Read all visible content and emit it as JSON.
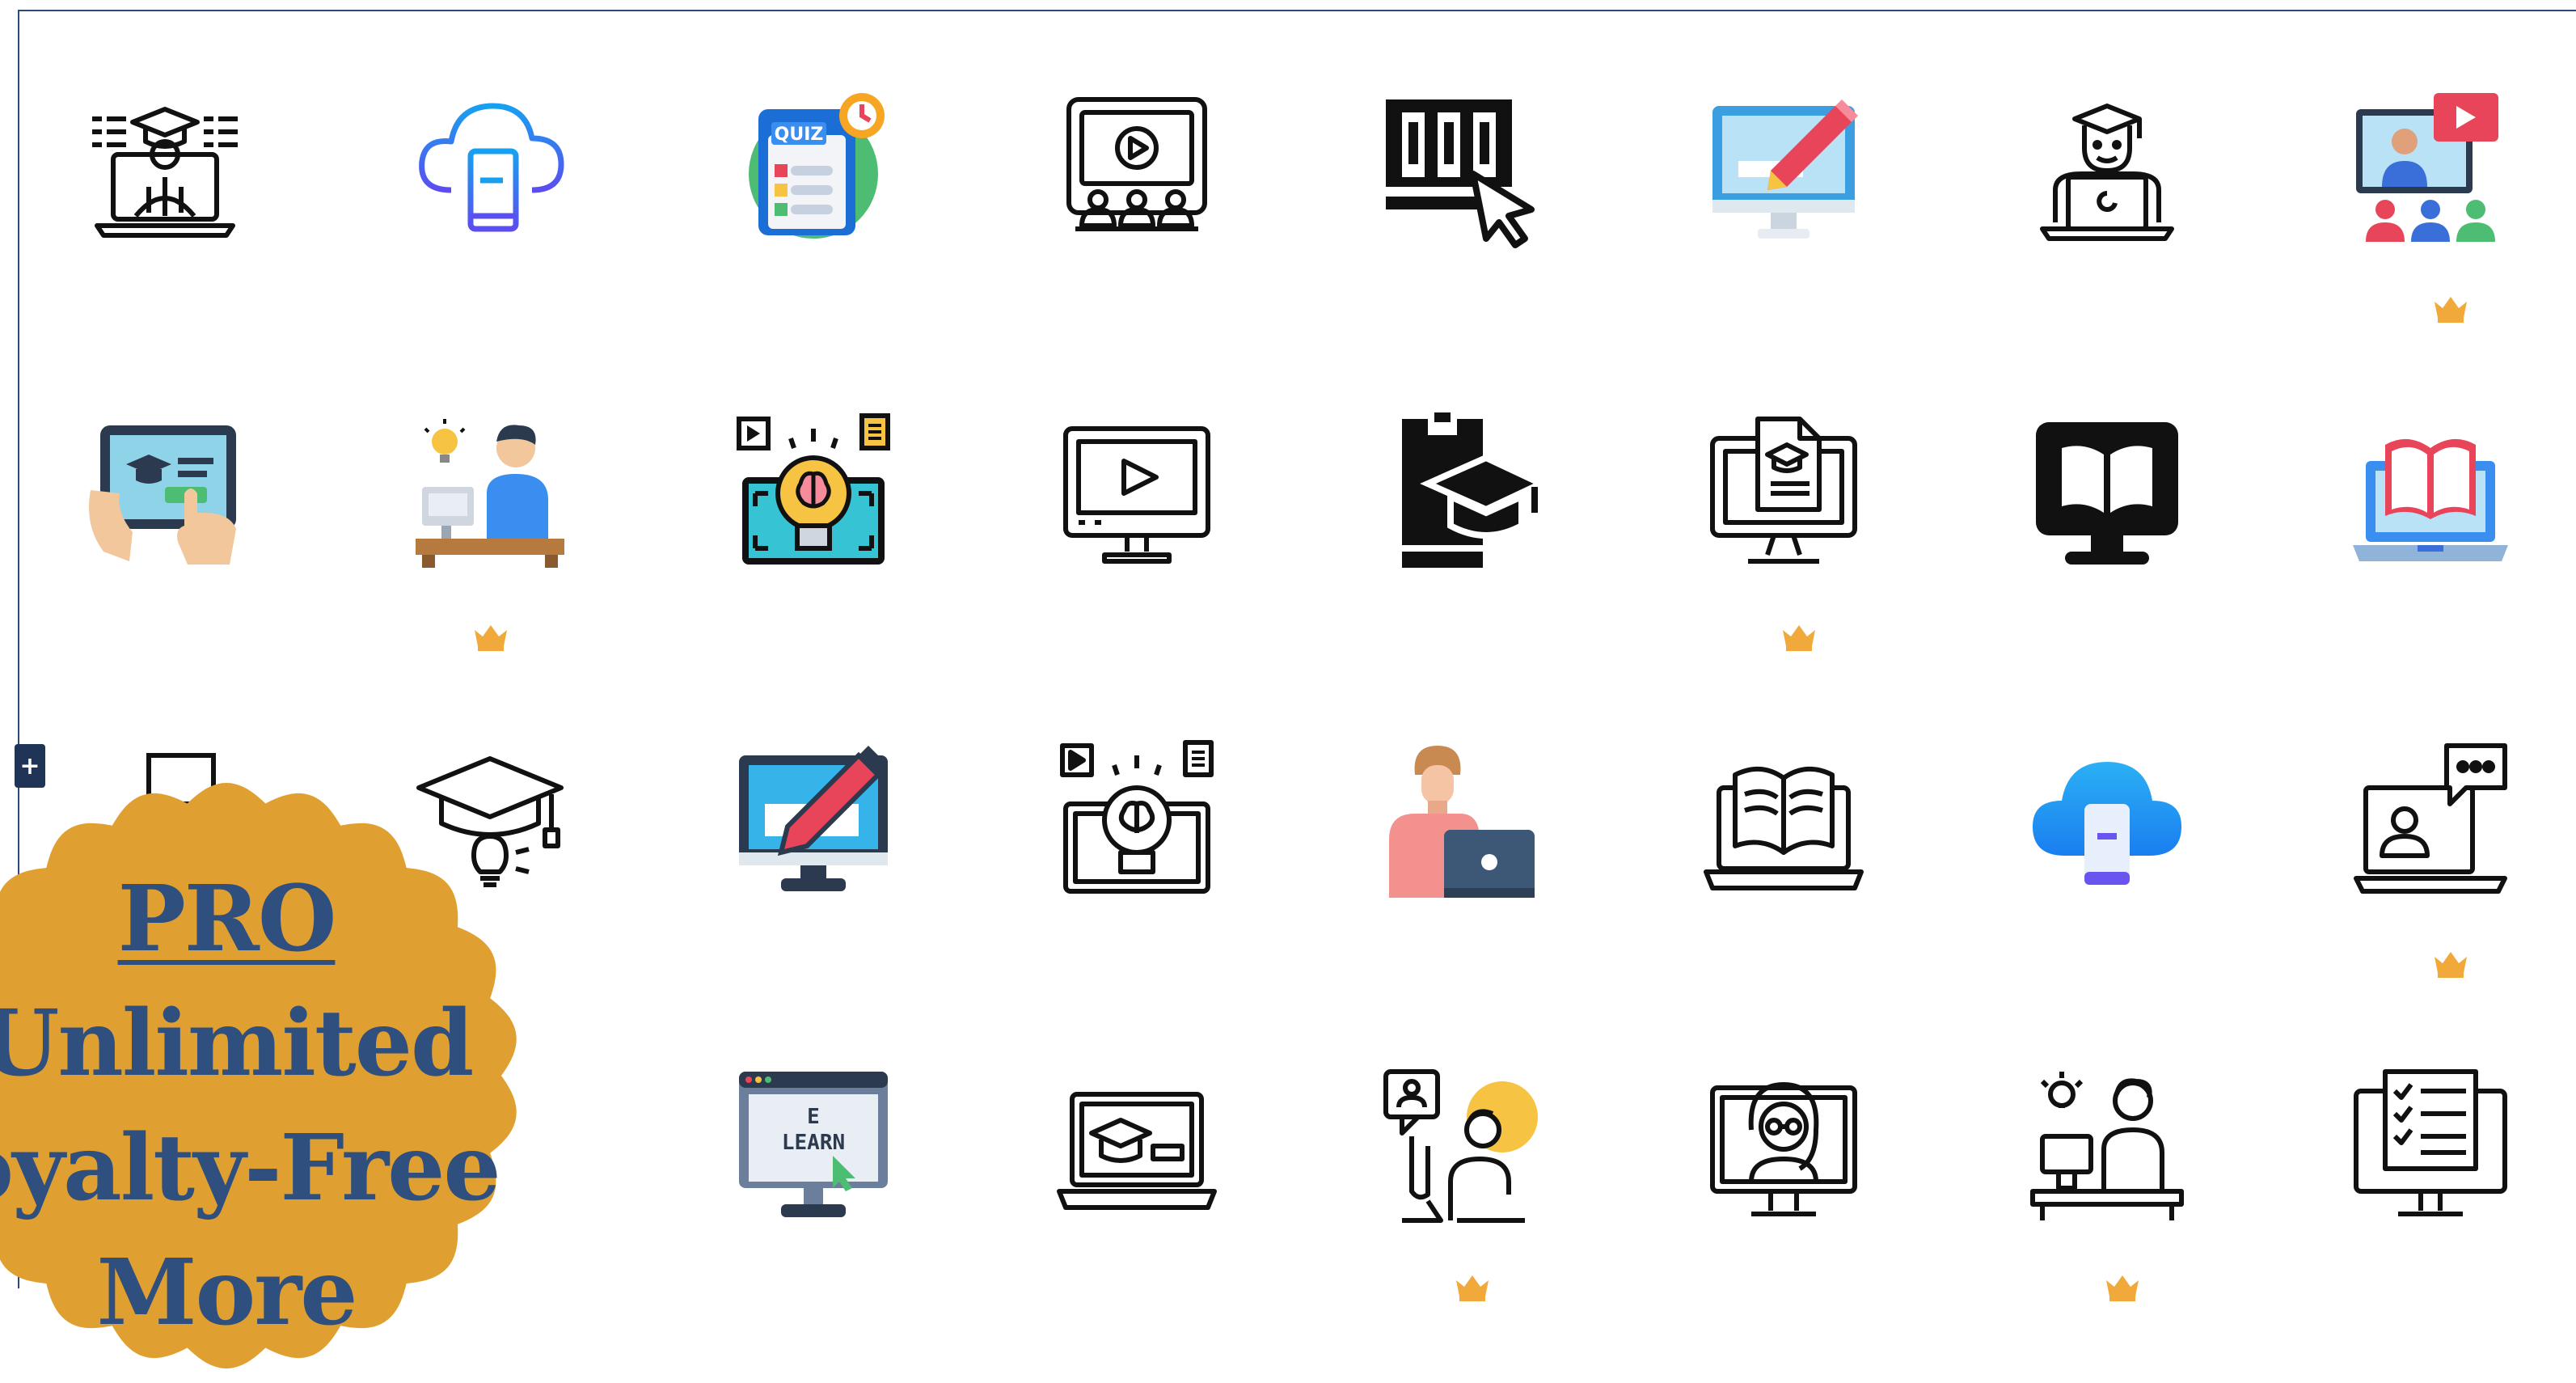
{
  "colors": {
    "frame_border": "#2c4a7c",
    "crown_gold": "#f0a93a",
    "promo_badge": "#e09f31",
    "promo_text": "#2f4f7f",
    "plus_button": "#1f3457"
  },
  "icons": [
    {
      "name": "online-graduate-laptop-icon",
      "style": "line",
      "pro": false
    },
    {
      "name": "cloud-book-icon",
      "style": "gradient",
      "pro": false
    },
    {
      "name": "quiz-icon",
      "style": "flat",
      "pro": false,
      "label": "QUIZ"
    },
    {
      "name": "video-presentation-icon",
      "style": "line",
      "pro": false
    },
    {
      "name": "library-click-icon",
      "style": "glyph",
      "pro": false
    },
    {
      "name": "monitor-pencil-icon",
      "style": "flat",
      "pro": false
    },
    {
      "name": "student-laptop-icon",
      "style": "line",
      "pro": false
    },
    {
      "name": "video-conference-icon",
      "style": "flat",
      "pro": true
    },
    {
      "name": "tablet-graduation-icon",
      "style": "flat",
      "pro": false
    },
    {
      "name": "student-desk-idea-icon",
      "style": "flat",
      "pro": true
    },
    {
      "name": "brain-bulb-screen-icon",
      "style": "flat",
      "pro": false
    },
    {
      "name": "monitor-play-icon",
      "style": "line",
      "pro": false
    },
    {
      "name": "phone-graduation-icon",
      "style": "glyph",
      "pro": false
    },
    {
      "name": "monitor-diploma-icon",
      "style": "line",
      "pro": true
    },
    {
      "name": "monitor-book-icon",
      "style": "glyph",
      "pro": false
    },
    {
      "name": "laptop-book-icon",
      "style": "flat",
      "pro": false
    },
    {
      "name": "partial-icon",
      "style": "line",
      "pro": false
    },
    {
      "name": "graduation-cap-bulb-icon",
      "style": "line",
      "pro": false
    },
    {
      "name": "monitor-pencil-flat-icon",
      "style": "flat",
      "pro": false
    },
    {
      "name": "brain-bulb-line-icon",
      "style": "line",
      "pro": false
    },
    {
      "name": "person-laptop-icon",
      "style": "flat",
      "pro": false
    },
    {
      "name": "laptop-open-book-icon",
      "style": "line",
      "pro": false
    },
    {
      "name": "cloud-phone-icon",
      "style": "gradient",
      "pro": false
    },
    {
      "name": "video-chat-icon",
      "style": "line",
      "pro": true
    },
    {
      "name": "hidden-icon-1",
      "style": "line",
      "pro": false
    },
    {
      "name": "hidden-icon-2",
      "style": "line",
      "pro": false
    },
    {
      "name": "e-learn-monitor-icon",
      "style": "flat",
      "pro": false,
      "label": "E LEARN"
    },
    {
      "name": "laptop-graduation-icon",
      "style": "line",
      "pro": false
    },
    {
      "name": "student-question-icon",
      "style": "line",
      "pro": true
    },
    {
      "name": "teacher-monitor-icon",
      "style": "line",
      "pro": false
    },
    {
      "name": "student-desk-bulb-icon",
      "style": "line",
      "pro": true
    },
    {
      "name": "monitor-checklist-icon",
      "style": "line",
      "pro": false
    }
  ],
  "promo": {
    "line1": "PRO",
    "line2": "Unlimited",
    "line3": "oyalty-Free",
    "line4": "More"
  },
  "plus_button": {
    "label": "+"
  }
}
